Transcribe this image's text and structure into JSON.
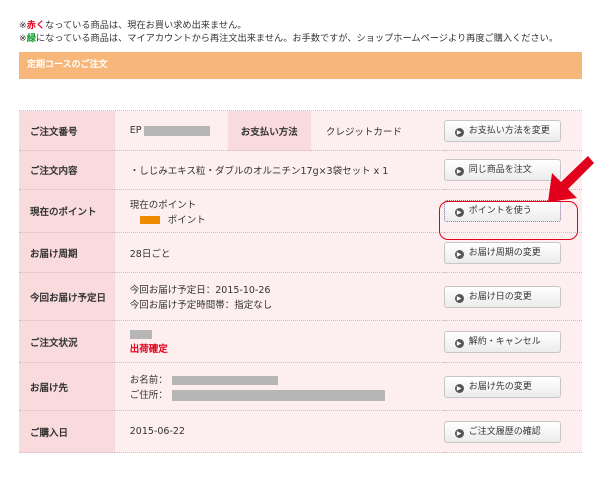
{
  "notices": {
    "line1": {
      "prefix": "※",
      "highlight": "赤く",
      "rest": "なっている商品は、現在お買い求め出来ません。"
    },
    "line2": {
      "prefix": "※",
      "highlight": "緑",
      "rest": "になっている商品は、マイアカウントから再注文出来ません。お手数ですが、ショップホームページより再度ご購入ください。"
    }
  },
  "section_title": "定期コースのご注文",
  "rows": {
    "order_no": {
      "label": "ご注文番号",
      "value_prefix": "EP",
      "payment_label": "お支払い方法",
      "payment_value": "クレジットカード",
      "button": "お支払い方法を変更"
    },
    "contents": {
      "label": "ご注文内容",
      "value": "・しじみエキス粒・ダブルのオルニチン17g×3袋セット x 1",
      "button": "同じ商品を注文"
    },
    "points": {
      "label": "現在のポイント",
      "line1": "現在のポイント",
      "unit": "ポイント",
      "button": "ポイントを使う"
    },
    "cycle": {
      "label": "お届け周期",
      "value": "28日ごと",
      "button": "お届け周期の変更"
    },
    "next_delivery": {
      "label": "今回お届け予定日",
      "line1": "今回お届け予定日：2015-10-26",
      "line2": "今回お届け予定時間帯：指定なし",
      "button": "お届け日の変更"
    },
    "status": {
      "label": "ご注文状況",
      "value": "出荷確定",
      "button": "解約・キャンセル"
    },
    "destination": {
      "label": "お届け先",
      "name_label": "お名前：",
      "address_label": "ご住所：",
      "button": "お届け先の変更"
    },
    "purchase_date": {
      "label": "ご購入日",
      "value": "2015-06-22",
      "button": "ご注文履歴の確認"
    }
  },
  "icons": {
    "button_icon": "play-circle-icon",
    "annotation": "red-arrow-icon"
  },
  "colors": {
    "banner": "#f8b77a",
    "label_bg": "#f9dadd",
    "value_bg": "#fdeef0",
    "alert": "#e0001b",
    "green": "#119a2f",
    "points_bar": "#f08a00"
  }
}
